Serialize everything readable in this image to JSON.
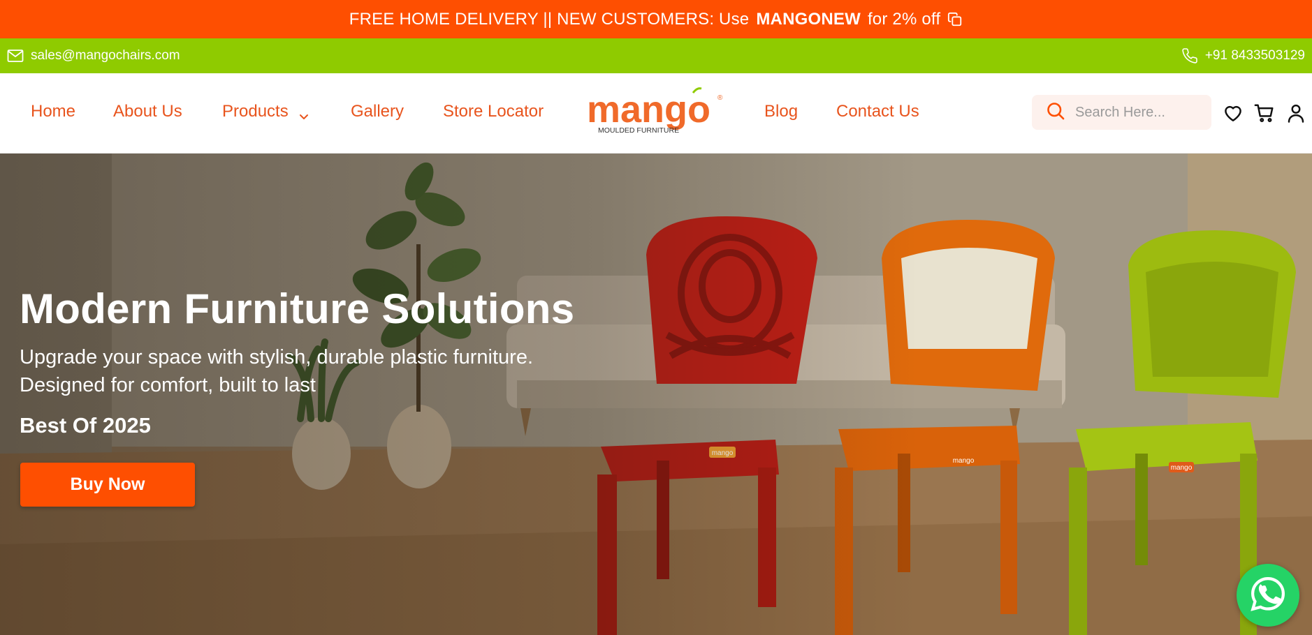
{
  "announcement": {
    "text_before": "FREE HOME DELIVERY || NEW CUSTOMERS: Use",
    "code": "MANGONEW",
    "text_after": "for 2% off",
    "icon": "copy-icon"
  },
  "contact_bar": {
    "email": "sales@mangochairs.com",
    "email_icon": "mail-icon",
    "phone": "+91 8433503129",
    "phone_icon": "phone-icon"
  },
  "nav": {
    "items": [
      {
        "label": "Home"
      },
      {
        "label": "About Us"
      },
      {
        "label": "Products",
        "dropdown": true
      },
      {
        "label": "Gallery"
      },
      {
        "label": "Store Locator"
      },
      {
        "label": "Blog"
      },
      {
        "label": "Contact Us"
      }
    ]
  },
  "logo": {
    "brand": "mango",
    "tagline": "MOULDED FURNITURE",
    "mark": "®"
  },
  "search": {
    "placeholder": "Search Here...",
    "value": ""
  },
  "header_icons": [
    "heart-icon",
    "cart-icon",
    "user-icon"
  ],
  "hero": {
    "title": "Modern Furniture Solutions",
    "subtitle_line1": "Upgrade your space with stylish, durable plastic furniture.",
    "subtitle_line2": "Designed for comfort, built to last",
    "tag": "Best Of 2025",
    "button": "Buy Now",
    "chair_badge": "mango"
  },
  "colors": {
    "primary_orange": "#fe4f01",
    "accent_green": "#8fcb00",
    "nav_text": "#e8541d",
    "whatsapp": "#25d366"
  }
}
